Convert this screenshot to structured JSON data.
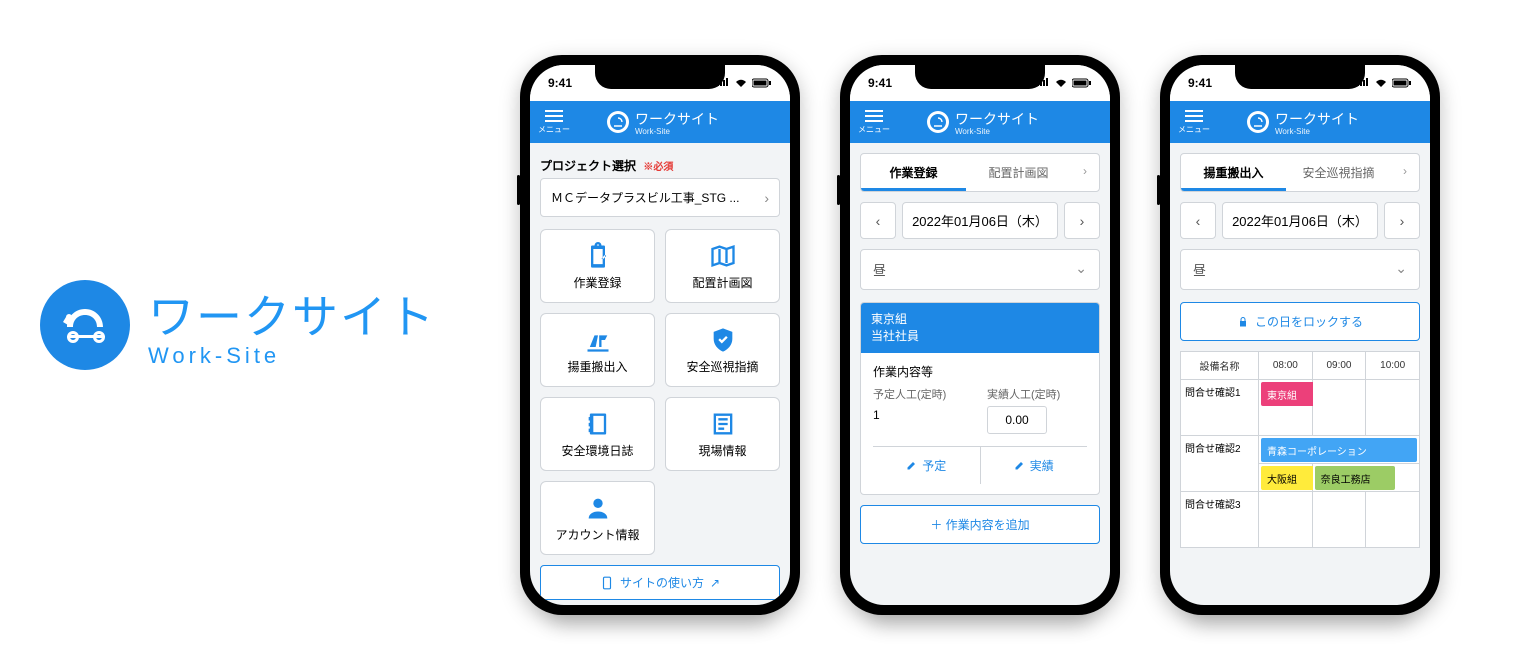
{
  "brand": {
    "jp": "ワークサイト",
    "en": "Work-Site"
  },
  "status": {
    "time": "9:41"
  },
  "appbar": {
    "menu": "メニュー",
    "title": "ワークサイト",
    "sub": "Work-Site"
  },
  "phone1": {
    "section_label": "プロジェクト選択",
    "required": "※必須",
    "project": "ＭＣデータプラスビル工事_STG ...",
    "tiles": {
      "t0": "作業登録",
      "t1": "配置計画図",
      "t2": "揚重搬出入",
      "t3": "安全巡視指摘",
      "t4": "安全環境日誌",
      "t5": "現場情報",
      "t6": "アカウント情報"
    },
    "help": "サイトの使い方"
  },
  "phone2": {
    "tabs": {
      "a": "作業登録",
      "b": "配置計画図"
    },
    "date": "2022年01月06日（木）",
    "shift": "昼",
    "card": {
      "org": "東京組",
      "role": "当社社員",
      "sec": "作業内容等",
      "plan_lbl": "予定人工(定時)",
      "plan_val": "1",
      "actual_lbl": "実績人工(定時)",
      "actual_val": "0.00",
      "btn_plan": "予定",
      "btn_actual": "実績"
    },
    "add": "＋ 作業内容を追加"
  },
  "phone3": {
    "tabs": {
      "a": "揚重搬出入",
      "b": "安全巡視指摘"
    },
    "date": "2022年01月06日（木）",
    "shift": "昼",
    "lock": "この日をロックする",
    "headers": {
      "equip": "設備名称",
      "h0": "08:00",
      "h1": "09:00",
      "h2": "10:00"
    },
    "rows": {
      "r0": "問合せ確認1",
      "r1": "問合せ確認2",
      "r2": "問合せ確認3"
    },
    "chips": {
      "c0": "東京組",
      "c1": "青森コーポレーション",
      "c2": "大阪組",
      "c3": "奈良工務店"
    }
  }
}
